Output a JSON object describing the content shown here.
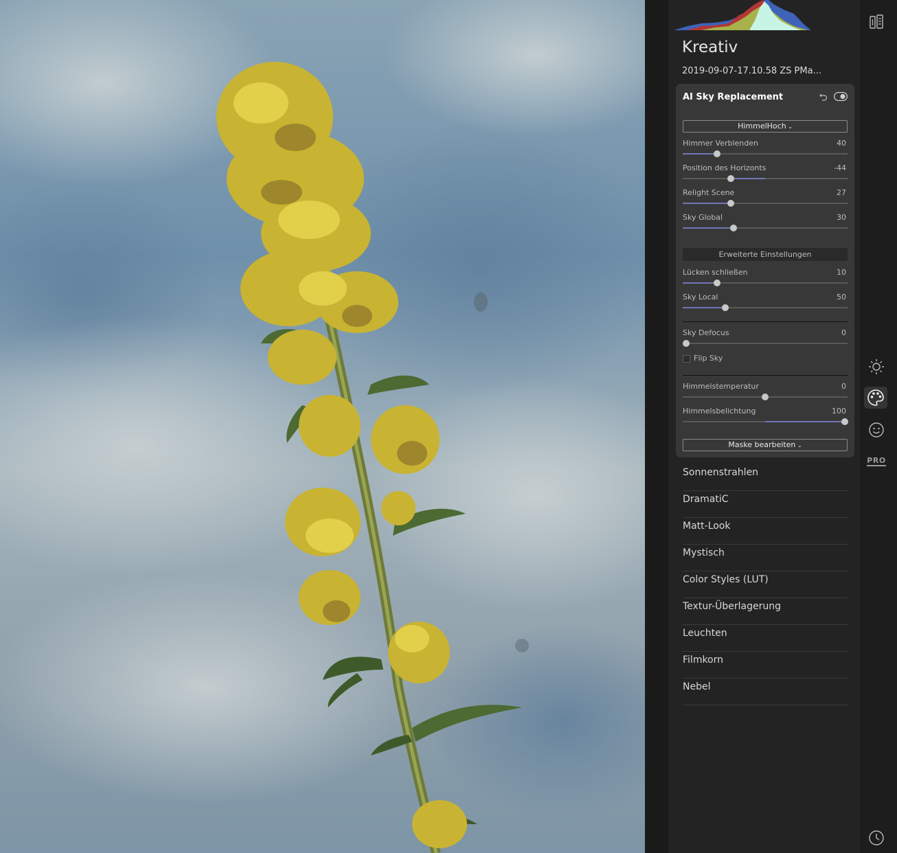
{
  "panel": {
    "title": "Kreativ",
    "file_name": "2019-09-07-17.10.58 ZS PMa..."
  },
  "sky_card": {
    "title": "AI Sky Replacement",
    "sky_preset": "HimmelHoch",
    "sliders_main": [
      {
        "label": "Himmer Verblenden",
        "value": 40,
        "fill": 0.21
      },
      {
        "label": " Position des Horizonts",
        "value": -44,
        "fill_from": 0.29,
        "fill_to": 0.5
      },
      {
        "label": "Relight Scene",
        "value": 27,
        "fill": 0.29
      },
      {
        "label": "Sky Global",
        "value": 30,
        "fill": 0.31
      }
    ],
    "advanced_label": "Erweiterte Einstellungen",
    "sliders_advanced": [
      {
        "label": "Lücken schließen",
        "value": 10,
        "fill": 0.21
      },
      {
        "label": "Sky Local",
        "value": 50,
        "fill": 0.26
      }
    ],
    "defocus": {
      "label": "Sky Defocus",
      "value": 0,
      "fill": 0.02
    },
    "flip_sky": {
      "label": "Flip Sky",
      "checked": false
    },
    "sliders_sky": [
      {
        "label": "Himmelstemperatur",
        "value": 0,
        "fill_from": 0.5,
        "fill_to": 0.5
      },
      {
        "label": "Himmelsbelichtung",
        "value": 100,
        "fill_from": 0.5,
        "fill_to": 0.985
      }
    ],
    "mask_label": "Maske bearbeiten"
  },
  "filters": [
    "Sonnenstrahlen",
    "DramatiC",
    "Matt-Look",
    "Mystisch",
    "Color Styles (LUT)",
    "Textur-Überlagerung",
    "Leuchten",
    "Filmkorn",
    "Nebel"
  ],
  "rail": {
    "pro_label": "PRO",
    "icons": [
      "layers-icon",
      "sun-icon",
      "palette-icon",
      "face-icon",
      "pro-icon",
      "history-icon"
    ]
  },
  "colors": {
    "accent": "#7077b8",
    "panel_bg": "#232323",
    "card_bg": "#383838"
  }
}
